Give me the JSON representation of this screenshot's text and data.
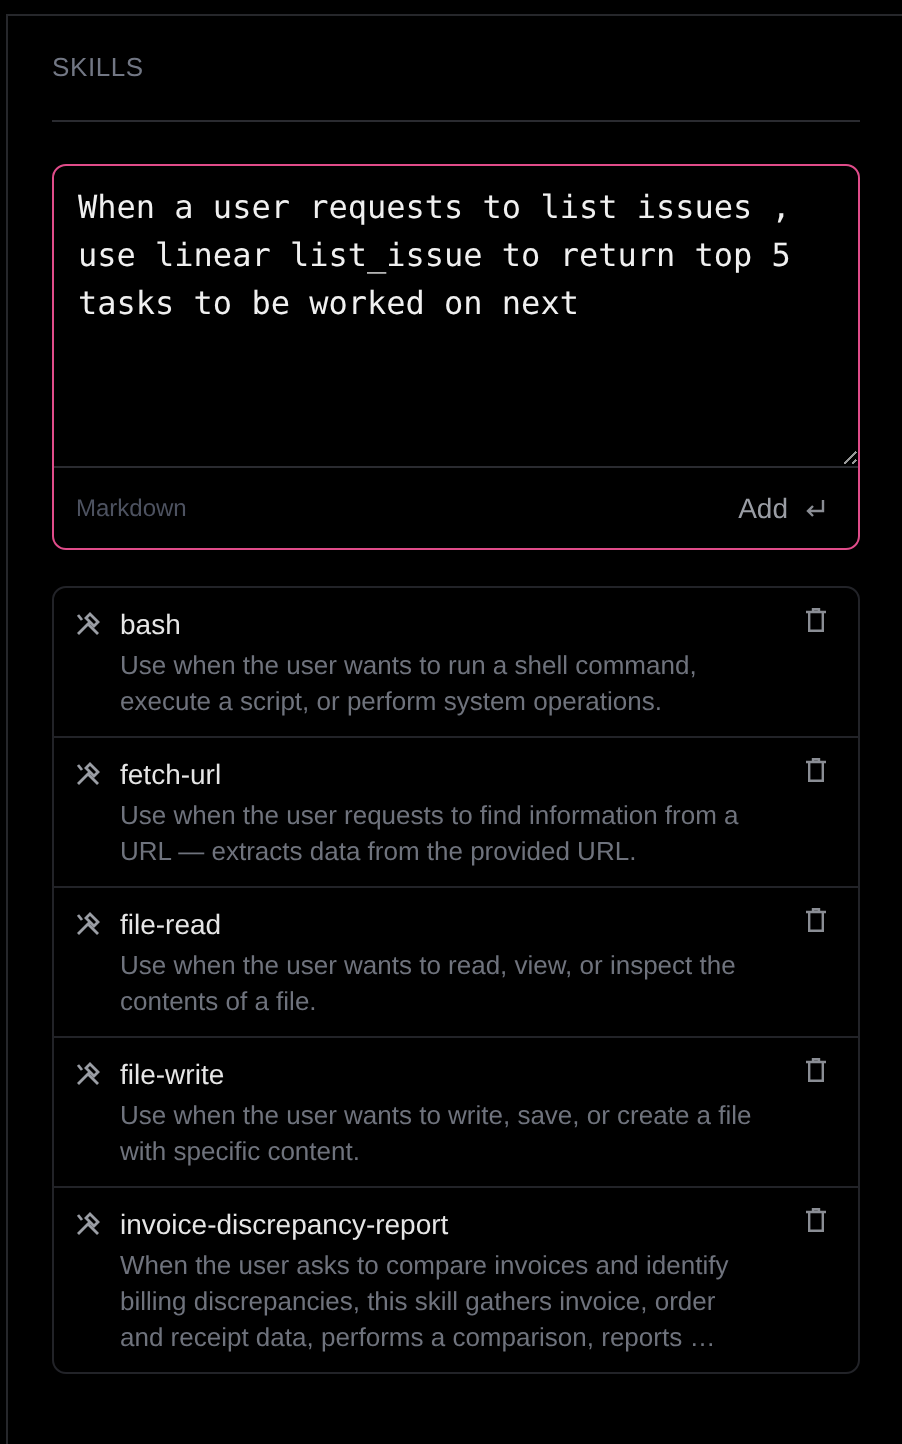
{
  "section": {
    "title": "SKILLS"
  },
  "editor": {
    "value": "When a user requests to list issues , use linear list_issue to return top 5 tasks to be worked on next",
    "format_label": "Markdown",
    "add_label": "Add",
    "focused": true
  },
  "skills": [
    {
      "name": "bash",
      "description": "Use when the user wants to run a shell command, execute a script, or perform system operations."
    },
    {
      "name": "fetch-url",
      "description": "Use when the user requests to find information from a URL — extracts data from the provided URL."
    },
    {
      "name": "file-read",
      "description": "Use when the user wants to read, view, or inspect the contents of a file."
    },
    {
      "name": "file-write",
      "description": "Use when the user wants to write, save, or create a file with specific content."
    },
    {
      "name": "invoice-discrepancy-report",
      "description": "When the user asks to compare invoices and identify billing discrepancies, this skill gathers invoice, order and receipt data, performs a comparison, reports …"
    }
  ]
}
